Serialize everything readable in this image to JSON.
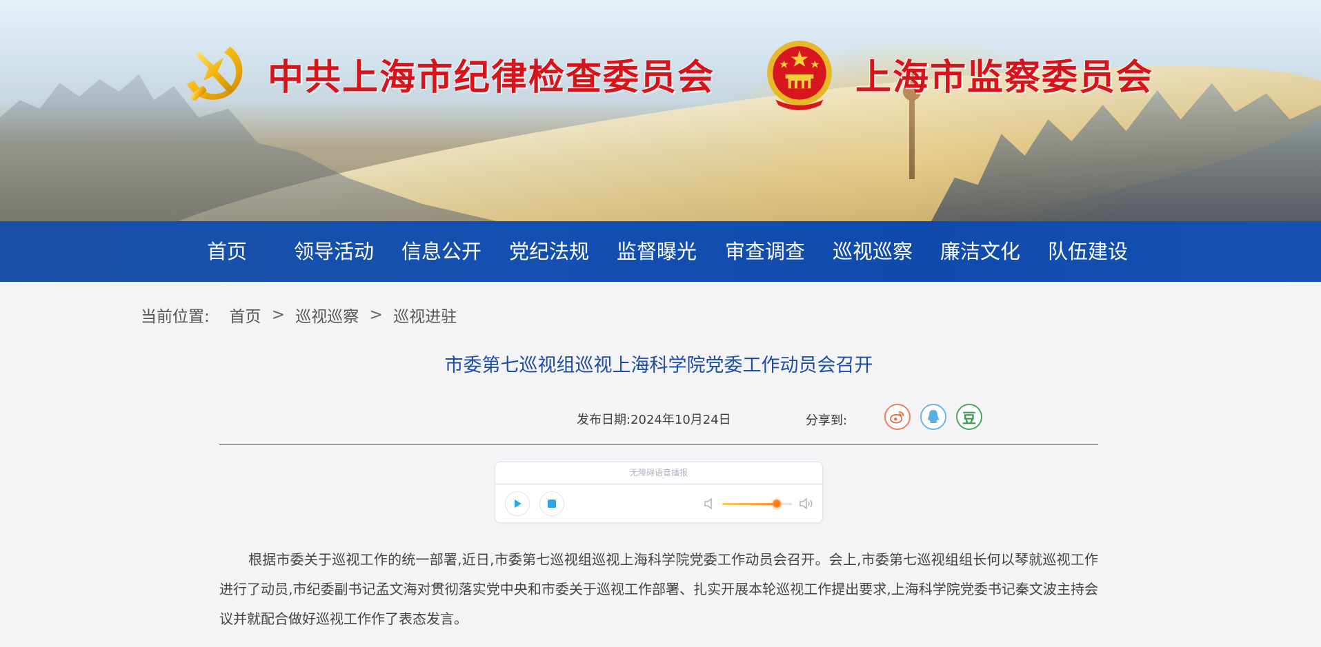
{
  "banner": {
    "party_title": "中共上海市纪律检查委员会",
    "state_title": "上海市监察委员会",
    "party_emblem_icon": "party-emblem-icon",
    "state_emblem_icon": "national-emblem-icon"
  },
  "nav": {
    "items": [
      {
        "label": "首页"
      },
      {
        "label": "领导活动"
      },
      {
        "label": "信息公开"
      },
      {
        "label": "党纪法规"
      },
      {
        "label": "监督曝光"
      },
      {
        "label": "审查调查"
      },
      {
        "label": "巡视巡察"
      },
      {
        "label": "廉洁文化"
      },
      {
        "label": "队伍建设"
      }
    ]
  },
  "breadcrumb": {
    "prefix": "当前位置:",
    "items": [
      "首页",
      "巡视巡察",
      "巡视进驻"
    ],
    "separator": ">"
  },
  "article": {
    "title": "市委第七巡视组巡视上海科学院党委工作动员会召开",
    "date_label": "发布日期:2024年10月24日",
    "share_label": "分享到:",
    "share": {
      "weibo_icon": "weibo-icon",
      "qq_icon": "qq-icon",
      "douban_label": "豆"
    },
    "body": "根据市委关于巡视工作的统一部署,近日,市委第七巡视组巡视上海科学院党委工作动员会召开。会上,市委第七巡视组组长何以琴就巡视工作进行了动员,市纪委副书记孟文海对贯彻落实党中央和市委关于巡视工作部署、扎实开展本轮巡视工作提出要求,上海科学院党委书记秦文波主持会议并就配合做好巡视工作作了表态发言。"
  },
  "player": {
    "label": "无障碍语音播报",
    "volume": 0.78
  },
  "colors": {
    "nav_bg": "#1450b3",
    "title_red": "#d6141a",
    "article_title": "#1c4ea6"
  }
}
